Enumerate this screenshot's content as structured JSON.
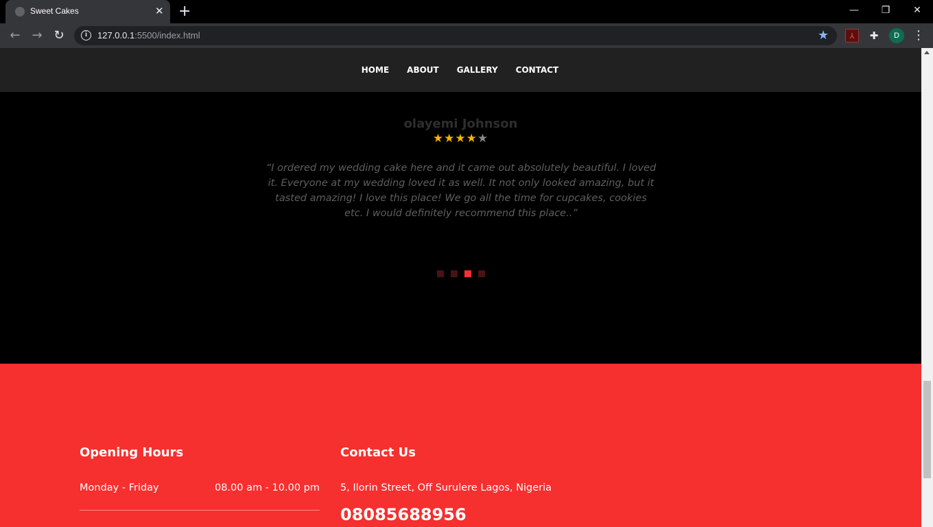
{
  "browser": {
    "tab_title": "Sweet Cakes",
    "tab_close": "✕",
    "new_tab": "+",
    "url_host": "127.0.0.1",
    "url_path": ":5500/index.html",
    "profile_initial": "D",
    "window_controls": {
      "minimize": "—",
      "restore": "❐",
      "close": "✕"
    },
    "icons": [
      "back-icon",
      "forward-icon",
      "reload-icon",
      "info-icon",
      "bookmark-star-icon",
      "pdf-extension-icon",
      "puzzle-icon",
      "kebab-menu-icon"
    ]
  },
  "nav": {
    "items": [
      {
        "label": "HOME"
      },
      {
        "label": "ABOUT"
      },
      {
        "label": "GALLERY"
      },
      {
        "label": "CONTACT"
      }
    ]
  },
  "testimonial": {
    "name": "olayemi Johnson",
    "rating": 4,
    "rating_max": 5,
    "quote": "“I ordered my wedding cake here and it came out absolutely beautiful. I loved it. Everyone at my wedding loved it as well. It not only looked amazing, but it tasted amazing! I love this place! We go all the time for cupcakes, cookies etc. I would definitely recommend this place..”",
    "slide_count": 4,
    "active_slide": 3
  },
  "footer": {
    "hours": {
      "title": "Opening Hours",
      "rows": [
        {
          "day": "Monday - Friday",
          "time": "08.00 am - 10.00 pm"
        }
      ]
    },
    "contact": {
      "title": "Contact Us",
      "address": "5, Ilorin Street, Off Surulere Lagos, Nigeria",
      "phone": "08085688956"
    }
  },
  "colors": {
    "accent": "#f62f2f",
    "star": "#f5b400",
    "nav_bg": "#212121",
    "page_bg": "#000000"
  }
}
